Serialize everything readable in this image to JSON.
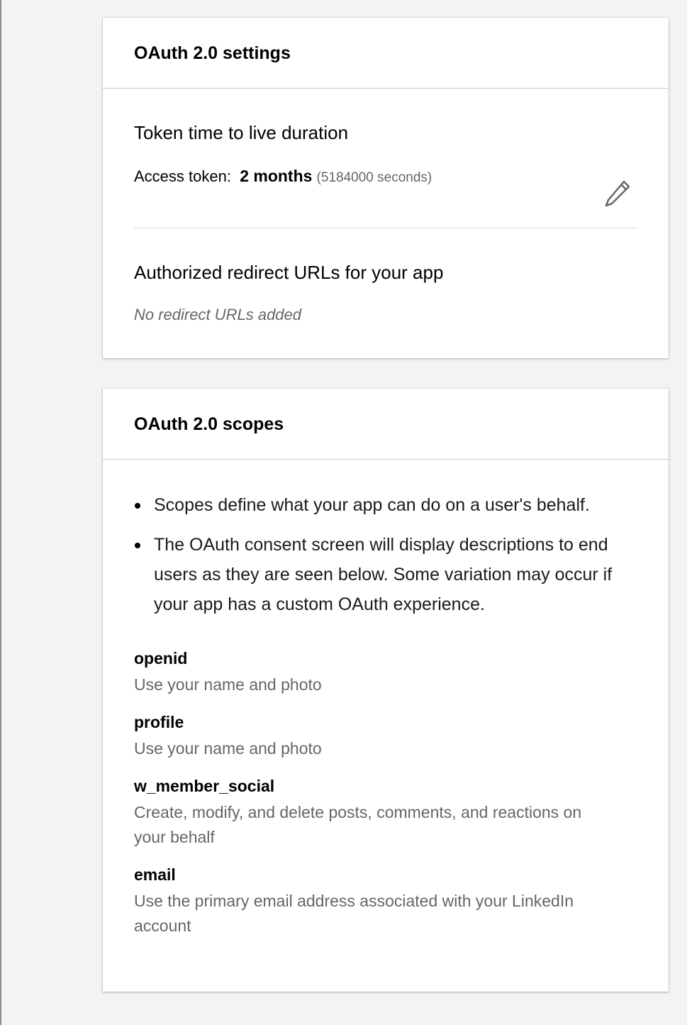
{
  "settings_card": {
    "title": "OAuth 2.0 settings",
    "token_heading": "Token time to live duration",
    "access_token_label": "Access token:",
    "access_token_value": "2 months",
    "access_token_seconds": "(5184000 seconds)",
    "redirect_heading": "Authorized redirect URLs for your app",
    "redirect_empty": "No redirect URLs added",
    "edit_icon": "pencil-icon"
  },
  "scopes_card": {
    "title": "OAuth 2.0 scopes",
    "bullets": [
      "Scopes define what your app can do on a user's behalf.",
      "The OAuth consent screen will display descriptions to end users as they are seen below. Some variation may occur if your app has a custom OAuth experience."
    ],
    "scopes": [
      {
        "name": "openid",
        "description": "Use your name and photo"
      },
      {
        "name": "profile",
        "description": "Use your name and photo"
      },
      {
        "name": "w_member_social",
        "description": "Create, modify, and delete posts, comments, and reactions on your behalf"
      },
      {
        "name": "email",
        "description": "Use the primary email address associated with your LinkedIn account"
      }
    ]
  }
}
